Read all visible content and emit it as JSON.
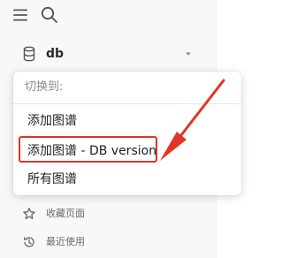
{
  "header": {
    "menu_icon": "hamburger-menu-icon",
    "search_icon": "search-icon"
  },
  "graph_selector": {
    "icon": "database-icon",
    "name": "db",
    "caret_icon": "caret-down-icon"
  },
  "dropdown": {
    "header": "切换到:",
    "items": [
      {
        "label": "添加图谱"
      },
      {
        "label": "添加图谱 - DB version",
        "highlighted": true
      },
      {
        "label": "所有图谱"
      }
    ]
  },
  "nav": {
    "items": [
      {
        "icon": "star-icon",
        "label": "收藏页面"
      },
      {
        "icon": "history-icon",
        "label": "最近使用"
      }
    ]
  },
  "annotation": {
    "color": "#e03528"
  }
}
